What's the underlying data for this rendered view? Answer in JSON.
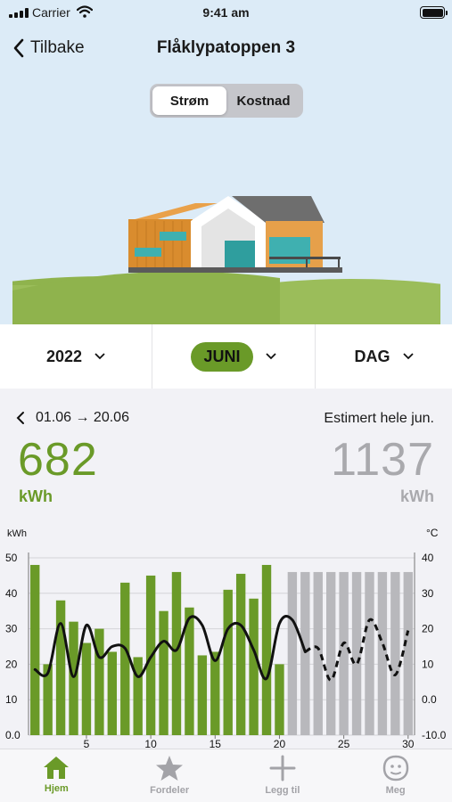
{
  "status_bar": {
    "carrier": "Carrier",
    "time": "9:41 am"
  },
  "nav": {
    "back_label": "Tilbake",
    "title": "Flåklypatoppen 3"
  },
  "segment": {
    "options": [
      "Strøm",
      "Kostnad"
    ],
    "selected": "Strøm"
  },
  "selectors": {
    "year": "2022",
    "month": "JUNI",
    "resolution": "DAG"
  },
  "summary": {
    "period": "01.06 → 20.06",
    "estimate_label": "Estimert hele jun.",
    "used_value": "682",
    "used_unit": "kWh",
    "estimated_value": "1137",
    "estimated_unit": "kWh"
  },
  "chart_data": {
    "type": "bar",
    "ylabel_left": "kWh",
    "ylabel_right": "°C",
    "ylim_left": [
      0,
      50
    ],
    "ylim_right": [
      -10,
      40
    ],
    "left_ticks": [
      "0.0",
      "10",
      "20",
      "30",
      "40",
      "50"
    ],
    "right_ticks": [
      "-10.0",
      "0.0",
      "10",
      "20",
      "30",
      "40"
    ],
    "x_ticks": [
      "5",
      "10",
      "15",
      "20",
      "25",
      "30"
    ],
    "days": [
      1,
      2,
      3,
      4,
      5,
      6,
      7,
      8,
      9,
      10,
      11,
      12,
      13,
      14,
      15,
      16,
      17,
      18,
      19,
      20,
      21,
      22,
      23,
      24,
      25,
      26,
      27,
      28,
      29,
      30
    ],
    "series": [
      {
        "kind": "actual",
        "color": "#6a9a28",
        "values": [
          48,
          20,
          38,
          32,
          26,
          30,
          23.5,
          43,
          22,
          45,
          35,
          46,
          36,
          22.5,
          23.5,
          41,
          45.5,
          38.5,
          48,
          20
        ]
      },
      {
        "kind": "estimated",
        "color": "#b8b8bc",
        "values": [
          46,
          46,
          46,
          46,
          46,
          46,
          46,
          46,
          46,
          46
        ]
      }
    ],
    "temperature": {
      "color": "#111111",
      "measured": [
        8.5,
        7.5,
        21.5,
        6.5,
        21,
        12,
        15,
        14.5,
        6.5,
        12,
        16.5,
        14,
        23,
        21,
        11,
        20,
        21,
        14,
        6,
        21.5,
        22.5,
        13.5
      ],
      "forecast": [
        13.5,
        14.5,
        5.5,
        16,
        10,
        22.5,
        16,
        7,
        19.5
      ]
    },
    "legend_visible": false,
    "grid": "horizontal"
  },
  "tabs": [
    {
      "label": "Hjem",
      "icon": "house-icon",
      "active": true
    },
    {
      "label": "Fordeler",
      "icon": "star-icon",
      "active": false
    },
    {
      "label": "Legg til",
      "icon": "plus-icon",
      "active": false
    },
    {
      "label": "Meg",
      "icon": "face-icon",
      "active": false
    }
  ],
  "colors": {
    "accent": "#6a9a28",
    "estimate": "#b8b8bc",
    "sky": "#dcebf7"
  }
}
